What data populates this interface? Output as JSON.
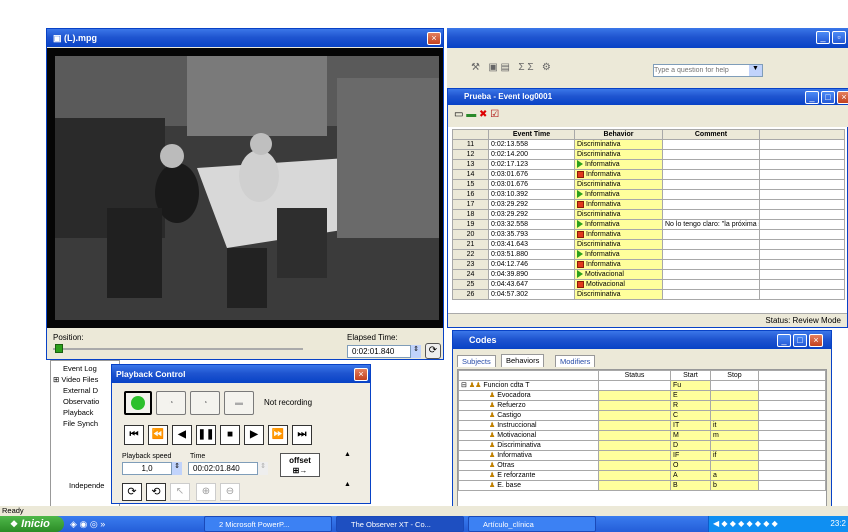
{
  "video": {
    "title": "(L).mpg",
    "position_label": "Position:",
    "elapsed_label": "Elapsed Time:",
    "elapsed_value": "0:02:01.840"
  },
  "menu_side": {
    "items": [
      "Event Log",
      "Video Files",
      "External D",
      "Observatio",
      "Playback",
      "File Synch"
    ],
    "independent": "Independe"
  },
  "playback": {
    "title": "Playback Control",
    "status": "Not recording",
    "speed_label": "Playback speed",
    "time_label": "Time",
    "speed_value": "1,0",
    "time_value": "00:02:01.840",
    "offset_label": "offset"
  },
  "toolbar": {
    "help_placeholder": "Type a question for help"
  },
  "eventlog": {
    "title": "Prueba - Event log0001",
    "headers": [
      "Event Time",
      "Behavior",
      "Comment"
    ],
    "status": "Status: Review Mode",
    "rows": [
      {
        "n": "11",
        "time": "0:02:13.558",
        "behavior": "Discriminativa",
        "icon": "",
        "comment": ""
      },
      {
        "n": "12",
        "time": "0:02:14.200",
        "behavior": "Discriminativa",
        "icon": "",
        "comment": ""
      },
      {
        "n": "13",
        "time": "0:02:17.123",
        "behavior": "Informativa",
        "icon": "start",
        "comment": ""
      },
      {
        "n": "14",
        "time": "0:03:01.676",
        "behavior": "Informativa",
        "icon": "stop",
        "comment": ""
      },
      {
        "n": "15",
        "time": "0:03:01.676",
        "behavior": "Discriminativa",
        "icon": "",
        "comment": ""
      },
      {
        "n": "16",
        "time": "0:03:10.392",
        "behavior": "Informativa",
        "icon": "start",
        "comment": ""
      },
      {
        "n": "17",
        "time": "0:03:29.292",
        "behavior": "Informativa",
        "icon": "stop",
        "comment": ""
      },
      {
        "n": "18",
        "time": "0:03:29.292",
        "behavior": "Discriminativa",
        "icon": "",
        "comment": ""
      },
      {
        "n": "19",
        "time": "0:03:32.558",
        "behavior": "Informativa",
        "icon": "start",
        "comment": "No lo tengo claro: \"la próxima s"
      },
      {
        "n": "20",
        "time": "0:03:35.793",
        "behavior": "Informativa",
        "icon": "stop",
        "comment": ""
      },
      {
        "n": "21",
        "time": "0:03:41.643",
        "behavior": "Discriminativa",
        "icon": "",
        "comment": ""
      },
      {
        "n": "22",
        "time": "0:03:51.880",
        "behavior": "Informativa",
        "icon": "start",
        "comment": ""
      },
      {
        "n": "23",
        "time": "0:04:12.746",
        "behavior": "Informativa",
        "icon": "stop",
        "comment": ""
      },
      {
        "n": "24",
        "time": "0:04:39.890",
        "behavior": "Motivacional",
        "icon": "start",
        "comment": ""
      },
      {
        "n": "25",
        "time": "0:04:43.647",
        "behavior": "Motivacional",
        "icon": "stop",
        "comment": ""
      },
      {
        "n": "26",
        "time": "0:04:57.302",
        "behavior": "Discriminativa",
        "icon": "",
        "comment": ""
      }
    ]
  },
  "codes": {
    "title": "Codes",
    "tabs": [
      "Subjects",
      "Behaviors",
      "Modifiers"
    ],
    "headers": [
      "Status",
      "Start",
      "Stop"
    ],
    "group": {
      "name": "Funcion cdta T",
      "start": "Fu"
    },
    "items": [
      {
        "name": "Evocadora",
        "start": "E",
        "stop": ""
      },
      {
        "name": "Refuerzo",
        "start": "R",
        "stop": ""
      },
      {
        "name": "Castigo",
        "start": "C",
        "stop": ""
      },
      {
        "name": "Instruccional",
        "start": "IT",
        "stop": "it"
      },
      {
        "name": "Motivacional",
        "start": "M",
        "stop": "m"
      },
      {
        "name": "Discriminativa",
        "start": "D",
        "stop": ""
      },
      {
        "name": "Informativa",
        "start": "IF",
        "stop": "if"
      },
      {
        "name": "Otras",
        "start": "O",
        "stop": ""
      },
      {
        "name": "E reforzante",
        "start": "A",
        "stop": "a"
      },
      {
        "name": "E. base",
        "start": "B",
        "stop": "b"
      }
    ]
  },
  "statusbar": {
    "text": "Ready"
  },
  "taskbar": {
    "start": "Inicio",
    "items": [
      "2 Microsoft PowerP...",
      "The Observer XT - Co...",
      "Artículo_clínica"
    ],
    "clock": "23:2"
  }
}
